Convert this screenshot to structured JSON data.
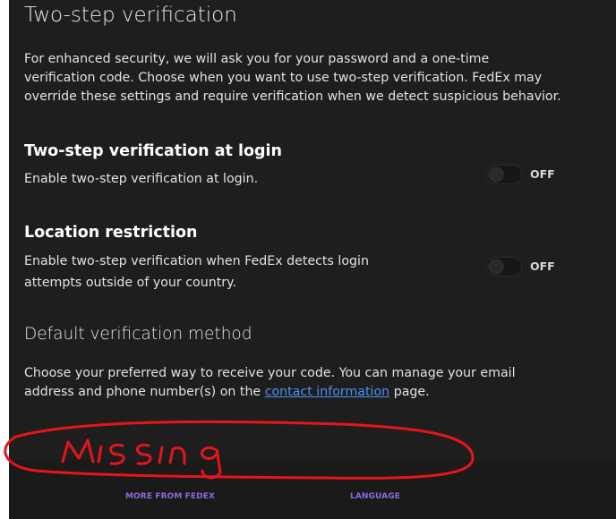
{
  "page": {
    "title": "Two-step verification",
    "intro": "For enhanced security, we will ask you for your password and a one-time verification code. Choose when you want to use two-step verification. FedEx may override these settings and require verification when we detect suspicious behavior."
  },
  "login_setting": {
    "title": "Two-step verification at login",
    "description": "Enable two-step verification at login.",
    "state": "OFF"
  },
  "location_setting": {
    "title": "Location restriction",
    "description_line1": "Enable two-step verification when FedEx detects login",
    "description_line2": "attempts outside of your country.",
    "state": "OFF"
  },
  "default_method": {
    "title": "Default verification method",
    "text_line1": "Choose your preferred way to receive your code. You can manage your email",
    "text_before_link": "address and phone number(s) on the ",
    "link_label": "contact information",
    "text_after_link": " page."
  },
  "annotation": {
    "text": "Missing",
    "color": "#e8141c"
  },
  "footer": {
    "more_label": "MORE FROM FEDEX",
    "language_label": "LANGUAGE",
    "link_color": "#8f6ad9"
  }
}
